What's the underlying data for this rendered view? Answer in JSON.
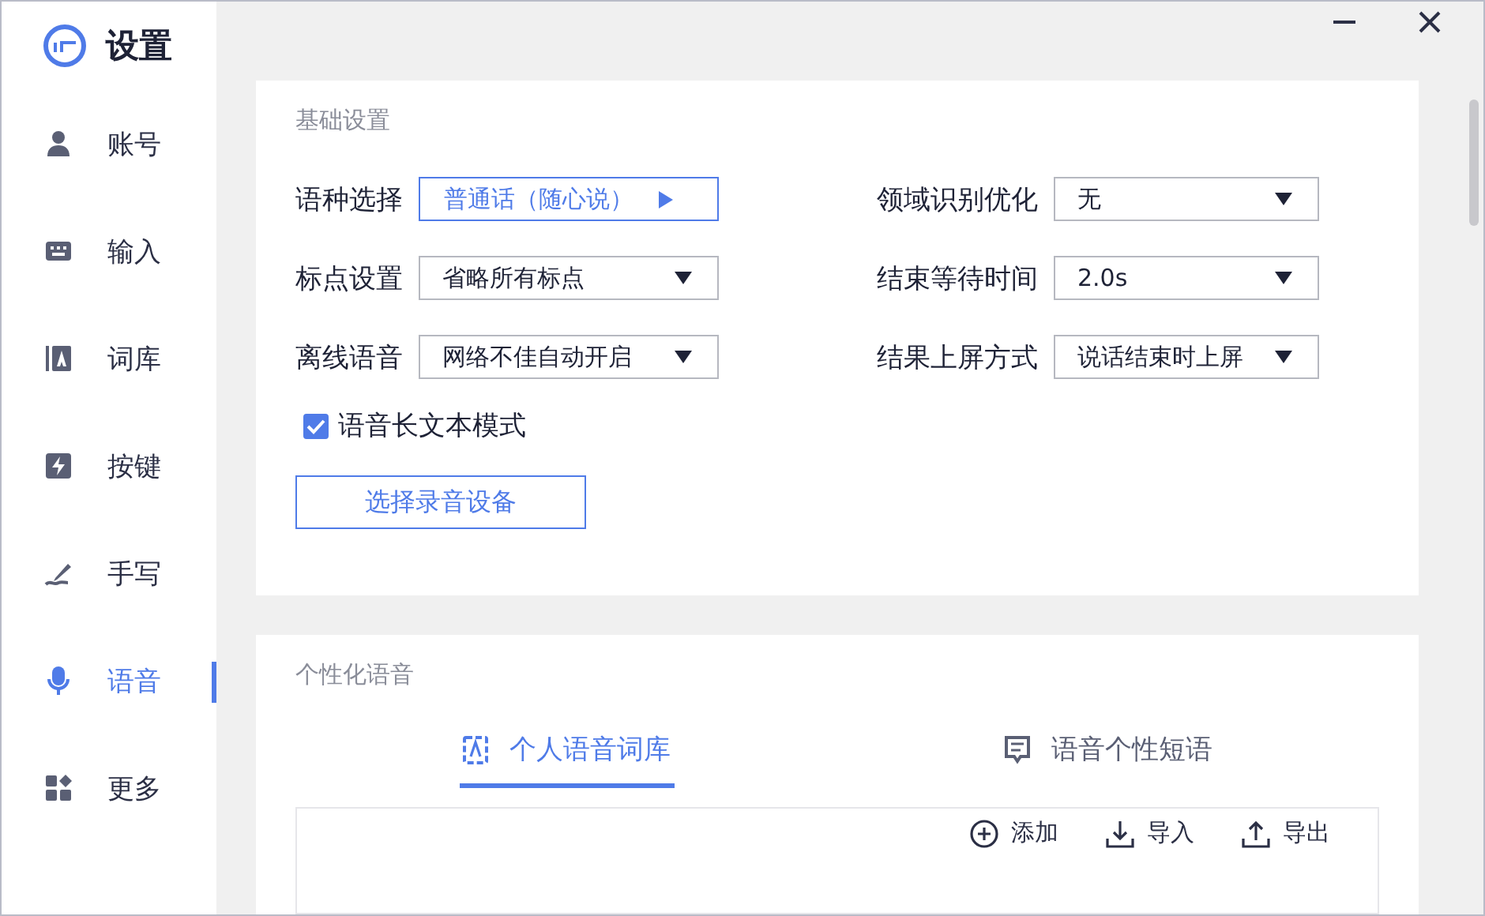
{
  "app": {
    "title": "设置"
  },
  "sidebar": {
    "items": [
      {
        "label": "账号",
        "selected": false
      },
      {
        "label": "输入",
        "selected": false
      },
      {
        "label": "词库",
        "selected": false
      },
      {
        "label": "按键",
        "selected": false
      },
      {
        "label": "手写",
        "selected": false
      },
      {
        "label": "语音",
        "selected": true
      },
      {
        "label": "更多",
        "selected": false
      }
    ]
  },
  "basic_settings": {
    "title": "基础设置",
    "fields": [
      {
        "label": "语种选择",
        "value": "普通话（随心说）",
        "kind": "picker"
      },
      {
        "label": "领域识别优化",
        "value": "无",
        "kind": "dropdown"
      },
      {
        "label": "标点设置",
        "value": "省略所有标点",
        "kind": "dropdown"
      },
      {
        "label": "结束等待时间",
        "value": "2.0s",
        "kind": "dropdown"
      },
      {
        "label": "离线语音",
        "value": "网络不佳自动开启",
        "kind": "dropdown"
      },
      {
        "label": "结果上屏方式",
        "value": "说话结束时上屏",
        "kind": "dropdown"
      }
    ],
    "checkbox": {
      "label": "语音长文本模式",
      "checked": true
    },
    "button": "选择录音设备"
  },
  "personal_voice": {
    "title": "个性化语音",
    "tabs": [
      {
        "label": "个人语音词库",
        "selected": true
      },
      {
        "label": "语音个性短语",
        "selected": false
      }
    ],
    "actions": [
      "添加",
      "导入",
      "导出"
    ]
  }
}
